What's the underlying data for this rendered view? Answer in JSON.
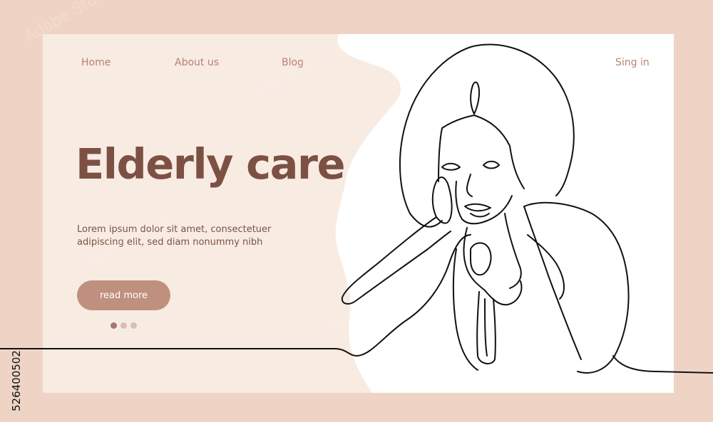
{
  "nav": {
    "home": "Home",
    "about": "About us",
    "blog": "Blog",
    "signin": "Sing in"
  },
  "hero": {
    "title": "Elderly care",
    "text": "Lorem ipsum dolor sit amet, consectetuer adipiscing elit, sed diam nonummy nibh",
    "button": "read more"
  },
  "carousel": {
    "dots": 3,
    "active": 1
  },
  "stock": {
    "id": "526400502"
  },
  "colors": {
    "background": "#efd4c6",
    "card": "#f8ebe2",
    "title": "#7c5144",
    "nav": "#b78272",
    "button": "#c0907f",
    "line_art": "#111111"
  },
  "icons": {
    "illustration": "elderly-woman-line-art-icon"
  }
}
